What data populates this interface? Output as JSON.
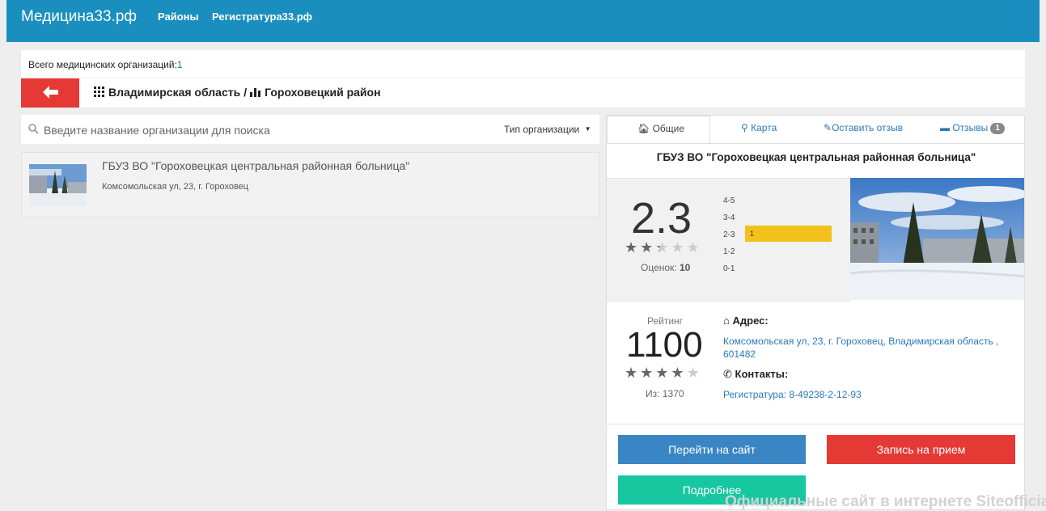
{
  "navbar": {
    "brand": "Медицина33.рф",
    "links": [
      "Районы",
      "Регистратура33.рф"
    ]
  },
  "summary": {
    "label": "Всего медицинских организаций:",
    "count": "1"
  },
  "breadcrumb": {
    "region": "Владимирская область",
    "separator": "/",
    "district": "Гороховецкий район"
  },
  "search": {
    "placeholder": "Введите название организации для поиска",
    "type_filter": "Тип организации"
  },
  "results": [
    {
      "name": "ГБУЗ ВО \"Гороховецкая центральная районная больница\"",
      "address": "Комсомольская ул, 23, г. Гороховец"
    }
  ],
  "panel": {
    "tabs": [
      {
        "label": "Общие",
        "icon": "home-icon"
      },
      {
        "label": "Карта",
        "icon": "map-marker-icon"
      },
      {
        "label": "Оставить отзыв",
        "icon": "pencil-icon"
      },
      {
        "label": "Отзывы",
        "icon": "comment-icon",
        "badge": "1"
      }
    ],
    "title": "ГБУЗ ВО \"Гороховецкая центральная районная больница\"",
    "score": "2.3",
    "score_stars": 2.3,
    "reviews_label": "Оценок:",
    "reviews_count": "10",
    "distribution": [
      {
        "range": "4-5",
        "count": null
      },
      {
        "range": "3-4",
        "count": null
      },
      {
        "range": "2-3",
        "count": "1"
      },
      {
        "range": "1-2",
        "count": null
      },
      {
        "range": "0-1",
        "count": null
      }
    ],
    "rating_label": "Рейтинг",
    "rating_value": "1100",
    "rating_stars": 4,
    "rating_of": "Из: 1370",
    "address_label": "Адрес:",
    "address_value": "Комсомольская ул, 23, г. Гороховец, Владимирская область , 601482",
    "contacts_label": "Контакты:",
    "contacts_value": "Регистратура: 8-49238-2-12-93"
  },
  "buttons": {
    "website": "Перейти на сайт",
    "appointment": "Запись на прием",
    "details": "Подробнее"
  },
  "watermark": "Официальные сайт в интернете Siteofficial.ru",
  "colors": {
    "navbar": "#1a8fbf",
    "red": "#e53935",
    "blue": "#3a86c5",
    "teal": "#16c7a0",
    "bar": "#f2c21b"
  }
}
